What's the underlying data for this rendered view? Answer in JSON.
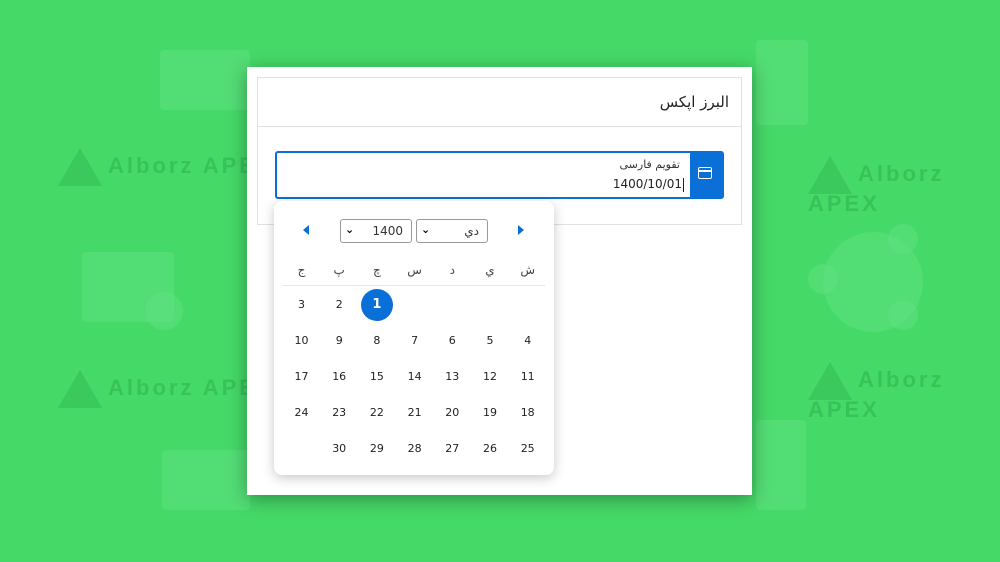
{
  "card": {
    "title": "البرز اپکس"
  },
  "date_input": {
    "label": "تقویم فارسی",
    "value": "1400/10/01"
  },
  "picker": {
    "year": "1400",
    "month": "دي",
    "weekdays": [
      "ش",
      "ي",
      "د",
      "س",
      "چ",
      "پ",
      "ج"
    ],
    "weeks": [
      [
        "",
        "",
        "",
        "",
        "1",
        "2",
        "3"
      ],
      [
        "4",
        "5",
        "6",
        "7",
        "8",
        "9",
        "10"
      ],
      [
        "11",
        "12",
        "13",
        "14",
        "15",
        "16",
        "17"
      ],
      [
        "18",
        "19",
        "20",
        "21",
        "22",
        "23",
        "24"
      ],
      [
        "25",
        "26",
        "27",
        "28",
        "29",
        "30",
        ""
      ]
    ],
    "selected_day": "1"
  },
  "colors": {
    "accent": "#0b6fd8",
    "background": "#45d968"
  },
  "background": {
    "watermark": "Alborz APEX"
  }
}
